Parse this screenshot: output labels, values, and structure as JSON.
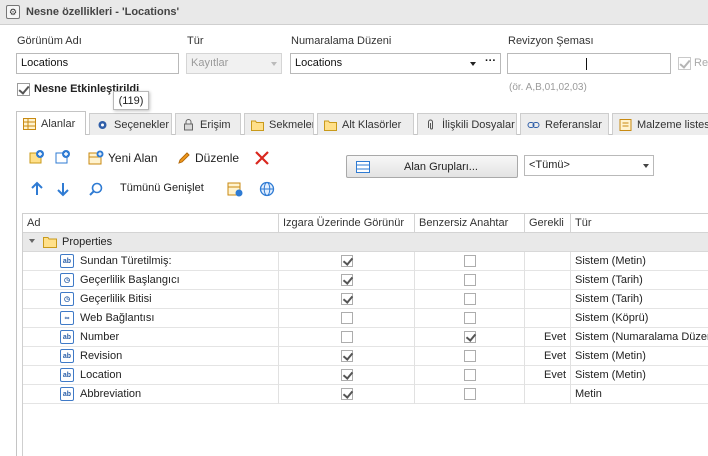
{
  "window": {
    "title": "Nesne özellikleri - 'Locations'"
  },
  "form": {
    "view_name_label": "Görünüm Adı",
    "view_name_value": "Locations",
    "type_label": "Tür",
    "type_value": "Kayıtlar",
    "numbering_label": "Numaralama Düzeni",
    "numbering_value": "Locations",
    "numbering_more": "···",
    "revision_label": "Revizyon Şeması",
    "revision_value": "",
    "revision_hint": "(ör. A,B,01,02,03)",
    "right_cut_label": "Re",
    "object_enabled_label": "Nesne Etkinleştirildi",
    "tooltip": "(119)"
  },
  "tabs": [
    {
      "label": "Alanlar",
      "icon": "grid-icon"
    },
    {
      "label": "Seçenekler",
      "icon": "gear-icon"
    },
    {
      "label": "Erişim",
      "icon": "lock-icon"
    },
    {
      "label": "Sekmeler",
      "icon": "folder-icon"
    },
    {
      "label": "Alt Klasörler",
      "icon": "folder-icon"
    },
    {
      "label": "İlişkili Dosyalar",
      "icon": "paperclip-icon"
    },
    {
      "label": "Referanslar",
      "icon": "link-icon"
    },
    {
      "label": "Malzeme listesi",
      "icon": "list-icon"
    }
  ],
  "toolbar": {
    "new_field": "Yeni Alan",
    "edit": "Düzenle",
    "expand_all": "Tümünü Genişlet",
    "field_groups": "Alan Grupları...",
    "filter_value": "<Tümü>"
  },
  "grid": {
    "columns": [
      "Ad",
      "Izgara Üzerinde Görünür",
      "Benzersiz Anahtar",
      "Gerekli",
      "Tür"
    ],
    "group": "Properties",
    "rows": [
      {
        "name": "Sundan Türetilmiş:",
        "icon": "ab",
        "visible": true,
        "unique": false,
        "required": "",
        "type": "Sistem (Metin)"
      },
      {
        "name": "Geçerlilik Başlangıcı",
        "icon": "clock",
        "visible": true,
        "unique": false,
        "required": "",
        "type": "Sistem (Tarih)"
      },
      {
        "name": "Geçerlilik Bitisi",
        "icon": "clock",
        "visible": true,
        "unique": false,
        "required": "",
        "type": "Sistem (Tarih)"
      },
      {
        "name": "Web Bağlantısı",
        "icon": "link",
        "visible": false,
        "unique": false,
        "required": "",
        "type": "Sistem (Köprü)"
      },
      {
        "name": "Number",
        "icon": "ab",
        "visible": false,
        "unique": true,
        "required": "Evet",
        "type": "Sistem (Numaralama Düzeni)"
      },
      {
        "name": "Revision",
        "icon": "ab",
        "visible": true,
        "unique": false,
        "required": "Evet",
        "type": "Sistem (Metin)"
      },
      {
        "name": "Location",
        "icon": "ab",
        "visible": true,
        "unique": false,
        "required": "Evet",
        "type": "Sistem (Metin)"
      },
      {
        "name": "Abbreviation",
        "icon": "ab",
        "visible": true,
        "unique": false,
        "required": "",
        "type": "Metin"
      }
    ]
  }
}
